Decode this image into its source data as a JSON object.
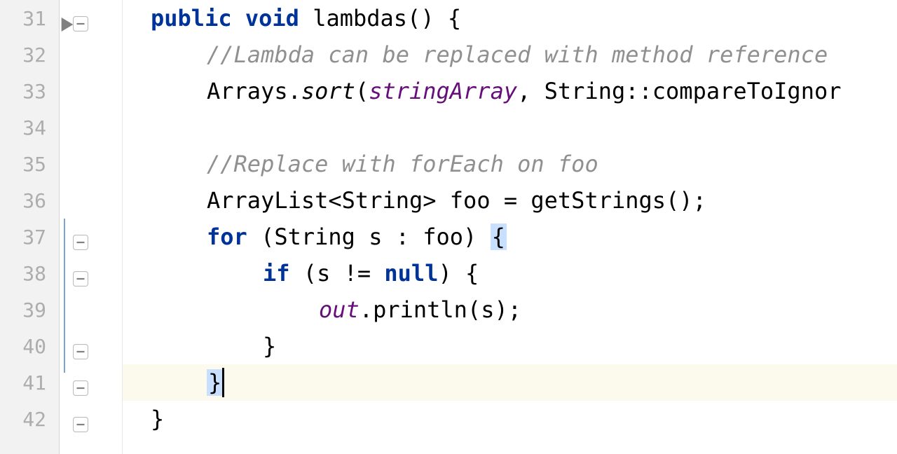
{
  "editor": {
    "lines": [
      {
        "number": "31",
        "tokens": [
          {
            "text": "public",
            "cls": "kw"
          },
          {
            "text": " ",
            "cls": "plain"
          },
          {
            "text": "void",
            "cls": "kw"
          },
          {
            "text": " lambdas() {",
            "cls": "plain"
          }
        ],
        "indent": 0,
        "foldStart": true,
        "runMarker": true
      },
      {
        "number": "32",
        "tokens": [
          {
            "text": "//Lambda can be replaced with method reference",
            "cls": "comment"
          }
        ],
        "indent": 1
      },
      {
        "number": "33",
        "tokens": [
          {
            "text": "Arrays.",
            "cls": "plain"
          },
          {
            "text": "sort",
            "cls": "method-italic"
          },
          {
            "text": "(",
            "cls": "plain"
          },
          {
            "text": "stringArray",
            "cls": "field"
          },
          {
            "text": ", String::compareToIgnor",
            "cls": "plain"
          }
        ],
        "indent": 1,
        "vcsMarker": true
      },
      {
        "number": "34",
        "tokens": [],
        "indent": 1
      },
      {
        "number": "35",
        "tokens": [
          {
            "text": "//Replace with forEach on foo",
            "cls": "comment"
          }
        ],
        "indent": 1
      },
      {
        "number": "36",
        "tokens": [
          {
            "text": "ArrayList<String> foo = getStrings();",
            "cls": "plain"
          }
        ],
        "indent": 1
      },
      {
        "number": "37",
        "tokens": [
          {
            "text": "for",
            "cls": "kw"
          },
          {
            "text": " (String s : foo) ",
            "cls": "plain"
          },
          {
            "text": "{",
            "cls": "brace-match"
          }
        ],
        "indent": 1,
        "foldStart": true
      },
      {
        "number": "38",
        "tokens": [
          {
            "text": "if",
            "cls": "kw"
          },
          {
            "text": " (s != ",
            "cls": "plain"
          },
          {
            "text": "null",
            "cls": "kw"
          },
          {
            "text": ") {",
            "cls": "plain"
          }
        ],
        "indent": 2,
        "foldStart": true
      },
      {
        "number": "39",
        "tokens": [
          {
            "text": "out",
            "cls": "field"
          },
          {
            "text": ".println(s);",
            "cls": "plain"
          }
        ],
        "indent": 3
      },
      {
        "number": "40",
        "tokens": [
          {
            "text": "}",
            "cls": "plain"
          }
        ],
        "indent": 2,
        "foldEnd": true
      },
      {
        "number": "41",
        "tokens": [
          {
            "text": "}",
            "cls": "brace-match"
          }
        ],
        "indent": 1,
        "currentLine": true,
        "cursor": true,
        "foldEnd": true
      },
      {
        "number": "42",
        "tokens": [
          {
            "text": "}",
            "cls": "plain"
          }
        ],
        "indent": 0,
        "foldEnd": true
      }
    ]
  }
}
